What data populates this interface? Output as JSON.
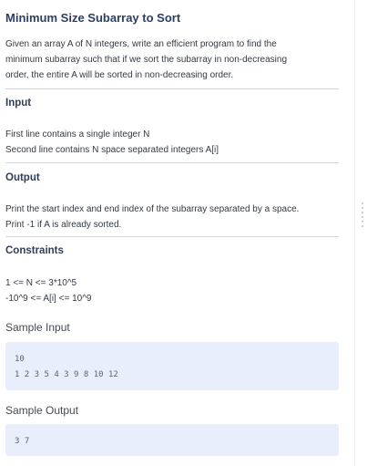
{
  "problem": {
    "title": "Minimum Size Subarray to Sort",
    "description": [
      "Given an array A of N integers, write an efficient program to find the",
      "minimum subarray such that if we sort the subarray in non-decreasing",
      "order, the entire A will be sorted in non-decreasing order."
    ]
  },
  "input": {
    "heading": "Input",
    "lines": [
      "First line contains a single integer N",
      "Second line contains N space separated integers A[i]"
    ]
  },
  "output": {
    "heading": "Output",
    "lines": [
      "Print the start index and end index of the subarray separated by a space.",
      "Print -1 if A is already sorted."
    ]
  },
  "constraints": {
    "heading": "Constraints",
    "lines": [
      "1 <= N <= 3*10^5",
      "-10^9 <= A[i] <= 10^9"
    ]
  },
  "sample_input": {
    "heading": "Sample Input",
    "lines": [
      "10",
      "1 2 3 5 4 3 9 8 10 12"
    ]
  },
  "sample_output": {
    "heading": "Sample Output",
    "lines": [
      "3 7"
    ]
  }
}
